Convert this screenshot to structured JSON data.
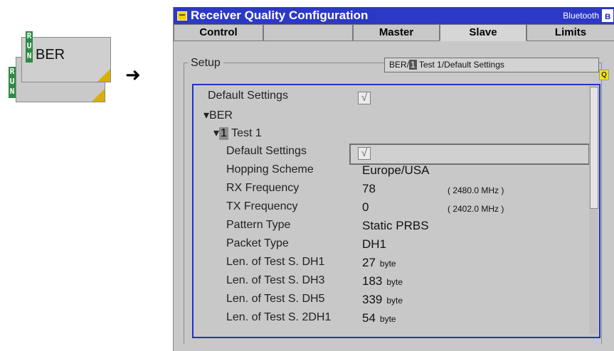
{
  "softkey": {
    "label": "BER",
    "run_letters": [
      "R",
      "U",
      "N"
    ]
  },
  "arrow": "➜",
  "dialog": {
    "title": "Receiver Quality Configuration",
    "mode": "Bluetooth",
    "tabs": [
      {
        "label": "Control"
      },
      {
        "label": ""
      },
      {
        "label": "Master"
      },
      {
        "label": "Slave"
      },
      {
        "label": "Limits"
      }
    ],
    "active_tab": "Slave",
    "setup_label": "Setup",
    "path": {
      "prefix": "BER/",
      "index": "1",
      "suffix": " Test 1/Default Settings"
    },
    "rows": [
      {
        "label": "Default Settings",
        "checked": true
      },
      {
        "label": "▾BER"
      },
      {
        "label_prefix": "▾",
        "index": "1",
        "label": " Test 1"
      },
      {
        "label": "Default Settings",
        "checked": true
      },
      {
        "label": "Hopping Scheme",
        "value": "Europe/USA"
      },
      {
        "label": "RX Frequency",
        "value": "78",
        "aux": "( 2480.0  MHz )"
      },
      {
        "label": "TX Frequency",
        "value": "0",
        "aux": "( 2402.0  MHz )"
      },
      {
        "label": "Pattern Type",
        "value": "Static PRBS"
      },
      {
        "label": "Packet Type",
        "value": "DH1"
      },
      {
        "label": "Len. of Test S. DH1",
        "value": "27",
        "unit": "byte"
      },
      {
        "label": "Len. of Test S. DH3",
        "value": "183",
        "unit": "byte"
      },
      {
        "label": "Len. of Test S. DH5",
        "value": "339",
        "unit": "byte"
      },
      {
        "label": "Len. of Test S. 2DH1",
        "value": "54",
        "unit": "byte"
      }
    ],
    "check_glyph": "√",
    "bt_glyph": "ʙ",
    "q_glyph": "Q"
  },
  "colors": {
    "title_bar": "#2c38c6",
    "focus_border": "#2233c8",
    "run": "#2f8a45",
    "accent": "#d8b000"
  }
}
